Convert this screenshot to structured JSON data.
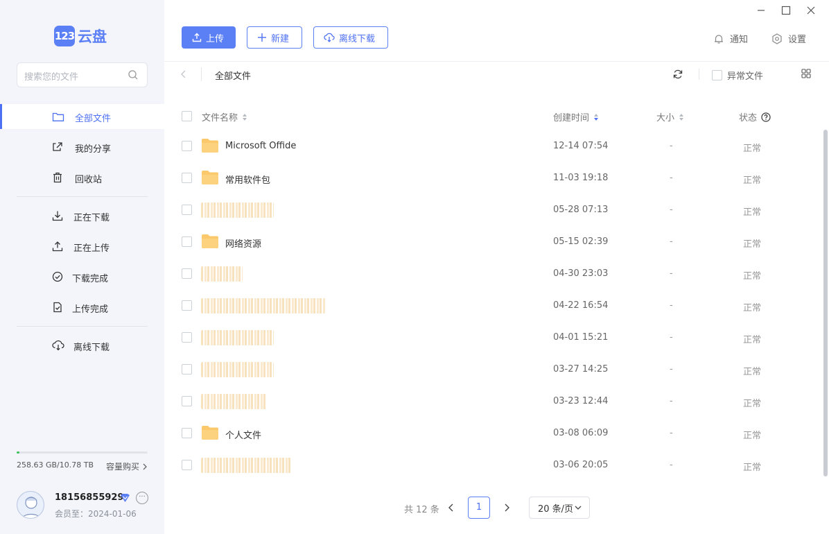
{
  "app": {
    "logo_badge": "123",
    "logo_text": "云盘"
  },
  "search": {
    "placeholder": "搜索您的文件"
  },
  "sidebar": {
    "nav": [
      {
        "label": "全部文件",
        "icon": "folder-icon",
        "active": true
      },
      {
        "label": "我的分享",
        "icon": "share-icon"
      },
      {
        "label": "回收站",
        "icon": "trash-icon"
      }
    ],
    "transfers": [
      {
        "label": "正在下载",
        "icon": "download-icon"
      },
      {
        "label": "正在上传",
        "icon": "upload-icon"
      },
      {
        "label": "下载完成",
        "icon": "check-circle-icon"
      },
      {
        "label": "上传完成",
        "icon": "file-check-icon"
      }
    ],
    "offline": {
      "label": "离线下载",
      "icon": "cloud-download-icon"
    },
    "storage": {
      "text": "258.63 GB/10.78 TB",
      "buy_label": "容量购买",
      "used_fraction": 0.023
    },
    "user": {
      "name": "18156855929",
      "member": "会员至：2024-01-06"
    }
  },
  "toolbar": {
    "upload_label": "上传",
    "new_label": "新建",
    "offline_label": "离线下载",
    "notify_label": "通知",
    "settings_label": "设置"
  },
  "breadcrumb": {
    "current": "全部文件"
  },
  "filter": {
    "abnormal_label": "异常文件"
  },
  "table": {
    "headers": {
      "name": "文件名称",
      "created": "创建时间",
      "size": "大小",
      "status": "状态"
    },
    "rows": [
      {
        "name": "Microsoft Offide",
        "date": "12-14 07:54",
        "size": "-",
        "status": "正常"
      },
      {
        "name": "常用软件包",
        "date": "11-03 19:18",
        "size": "-",
        "status": "正常"
      },
      {
        "name": "",
        "date": "05-28 07:13",
        "size": "-",
        "status": "正常"
      },
      {
        "name": "网络资源",
        "date": "05-15 02:39",
        "size": "-",
        "status": "正常"
      },
      {
        "name": "",
        "date": "04-30 23:03",
        "size": "-",
        "status": "正常"
      },
      {
        "name": "",
        "date": "04-22 16:54",
        "size": "-",
        "status": "正常"
      },
      {
        "name": "",
        "date": "04-01 15:21",
        "size": "-",
        "status": "正常"
      },
      {
        "name": "",
        "date": "03-27 14:25",
        "size": "-",
        "status": "正常"
      },
      {
        "name": "",
        "date": "03-23 12:44",
        "size": "-",
        "status": "正常"
      },
      {
        "name": "个人文件",
        "date": "03-08 06:09",
        "size": "-",
        "status": "正常"
      },
      {
        "name": "",
        "date": "03-06 20:05",
        "size": "-",
        "status": "正常"
      }
    ]
  },
  "pagination": {
    "total": "共 12 条",
    "current": "1",
    "page_size": "20 条/页"
  },
  "colors": {
    "accent": "#5b7ff5",
    "folder": "#fbc96b",
    "sidebar_bg": "#f3f5fa",
    "storage_fill": "#3cc35a"
  }
}
